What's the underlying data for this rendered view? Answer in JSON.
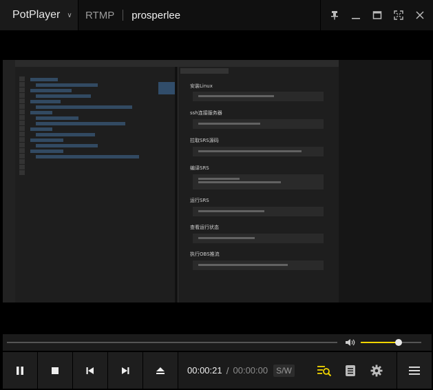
{
  "titlebar": {
    "app_name": "PotPlayer",
    "protocol": "RTMP",
    "stream_title": "prosperlee"
  },
  "video": {
    "content": "screen-share",
    "right_panel_headings": [
      "安装Linux",
      "ssh连接服务器",
      "拉取SRS源码",
      "编译SRS",
      "运行SRS",
      "查看运行状态",
      "执行OBS推流"
    ]
  },
  "playback": {
    "current_time": "00:00:21",
    "separator": "/",
    "duration": "00:00:00",
    "sw_label": "S/W",
    "seek_progress": 0,
    "volume": 0.63
  },
  "colors": {
    "accent": "#f1d400",
    "background": "#000000",
    "panel": "#1b1b1b"
  },
  "icons": {
    "pin": "pin-icon",
    "minimize": "minimize-icon",
    "maximize": "maximize-icon",
    "fullscreen": "fullscreen-icon",
    "close": "close-icon",
    "pause": "pause-icon",
    "stop": "stop-icon",
    "prev": "previous-icon",
    "next": "next-icon",
    "eject": "eject-icon",
    "volume": "speaker-icon",
    "playlist_search": "playlist-search-icon",
    "chapters": "chapter-list-icon",
    "settings": "gear-icon",
    "menu": "hamburger-menu-icon"
  }
}
